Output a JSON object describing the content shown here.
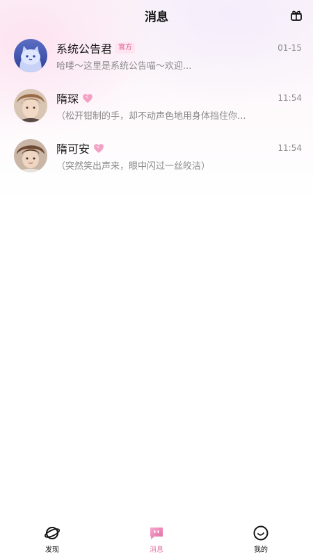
{
  "header": {
    "title": "消息",
    "action_icon": "gift-icon"
  },
  "conversations": [
    {
      "name": "系统公告君",
      "tag": "官方",
      "time": "01-15",
      "preview": "哈喽～这里是系统公告喵～欢迎...",
      "avatar": "cat-avatar"
    },
    {
      "name": "隋琛",
      "time": "11:54",
      "preview": "（松开钳制的手，却不动声色地用身体挡住你...",
      "avatar": "character-avatar",
      "badge_icon": "pink-heart-icon"
    },
    {
      "name": "隋可安",
      "time": "11:54",
      "preview": "（突然笑出声来，眼中闪过一丝皎洁）",
      "avatar": "character-avatar",
      "badge_icon": "pink-heart-icon"
    }
  ],
  "tabbar": {
    "tabs": [
      {
        "label": "发现",
        "icon": "planet-icon"
      },
      {
        "label": "消息",
        "icon": "chat-bubble-icon",
        "active": true
      },
      {
        "label": "我的",
        "icon": "smile-face-icon"
      }
    ]
  },
  "colors": {
    "accent": "#e37aa8",
    "tag_bg": "#fde4ef",
    "tag_text": "#e5558f"
  }
}
